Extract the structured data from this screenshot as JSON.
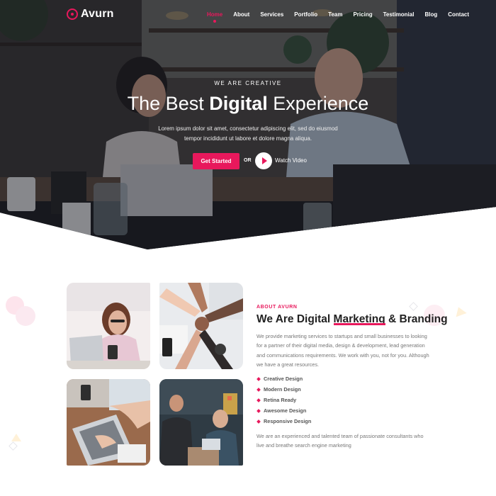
{
  "brand": {
    "name": "Avurn",
    "accent": "#e8185c"
  },
  "nav": {
    "items": [
      {
        "label": "Home",
        "active": true
      },
      {
        "label": "About",
        "active": false
      },
      {
        "label": "Services",
        "active": false
      },
      {
        "label": "Portfolio",
        "active": false
      },
      {
        "label": "Team",
        "active": false
      },
      {
        "label": "Pricing",
        "active": false
      },
      {
        "label": "Testimonial",
        "active": false
      },
      {
        "label": "Blog",
        "active": false
      },
      {
        "label": "Contact",
        "active": false
      }
    ]
  },
  "hero": {
    "eyebrow": "WE ARE CREATIVE",
    "headline_pre": "The Best ",
    "headline_highlight": "Digital",
    "headline_post": " Experience",
    "subtitle_line1": "Lorem ipsum dolor sit amet, consectetur adipiscing elit, sed do eiusmod",
    "subtitle_line2": "tempor incididunt ut labore et dolore magna aliqua.",
    "cta_label": "Get Started",
    "or_label": "OR",
    "video_label": "Watch Video"
  },
  "about": {
    "tag": "ABOUT AVURN",
    "title_pre": "We Are Digital ",
    "title_highlight": "Marketing",
    "title_post": " & Branding",
    "body": "We provide marketing services to startups and small businesses to looking for a partner of their digital media, design & development, lead generation and communications requirements. We work with you, not for you. Although we have a great resources.",
    "features": [
      "Creative Design",
      "Modern Design",
      "Retina Ready",
      "Awesome Design",
      "Responsive Design"
    ],
    "footer": "We are an experienced and talented team of passionate consultants who live and breathe search engine marketing"
  }
}
